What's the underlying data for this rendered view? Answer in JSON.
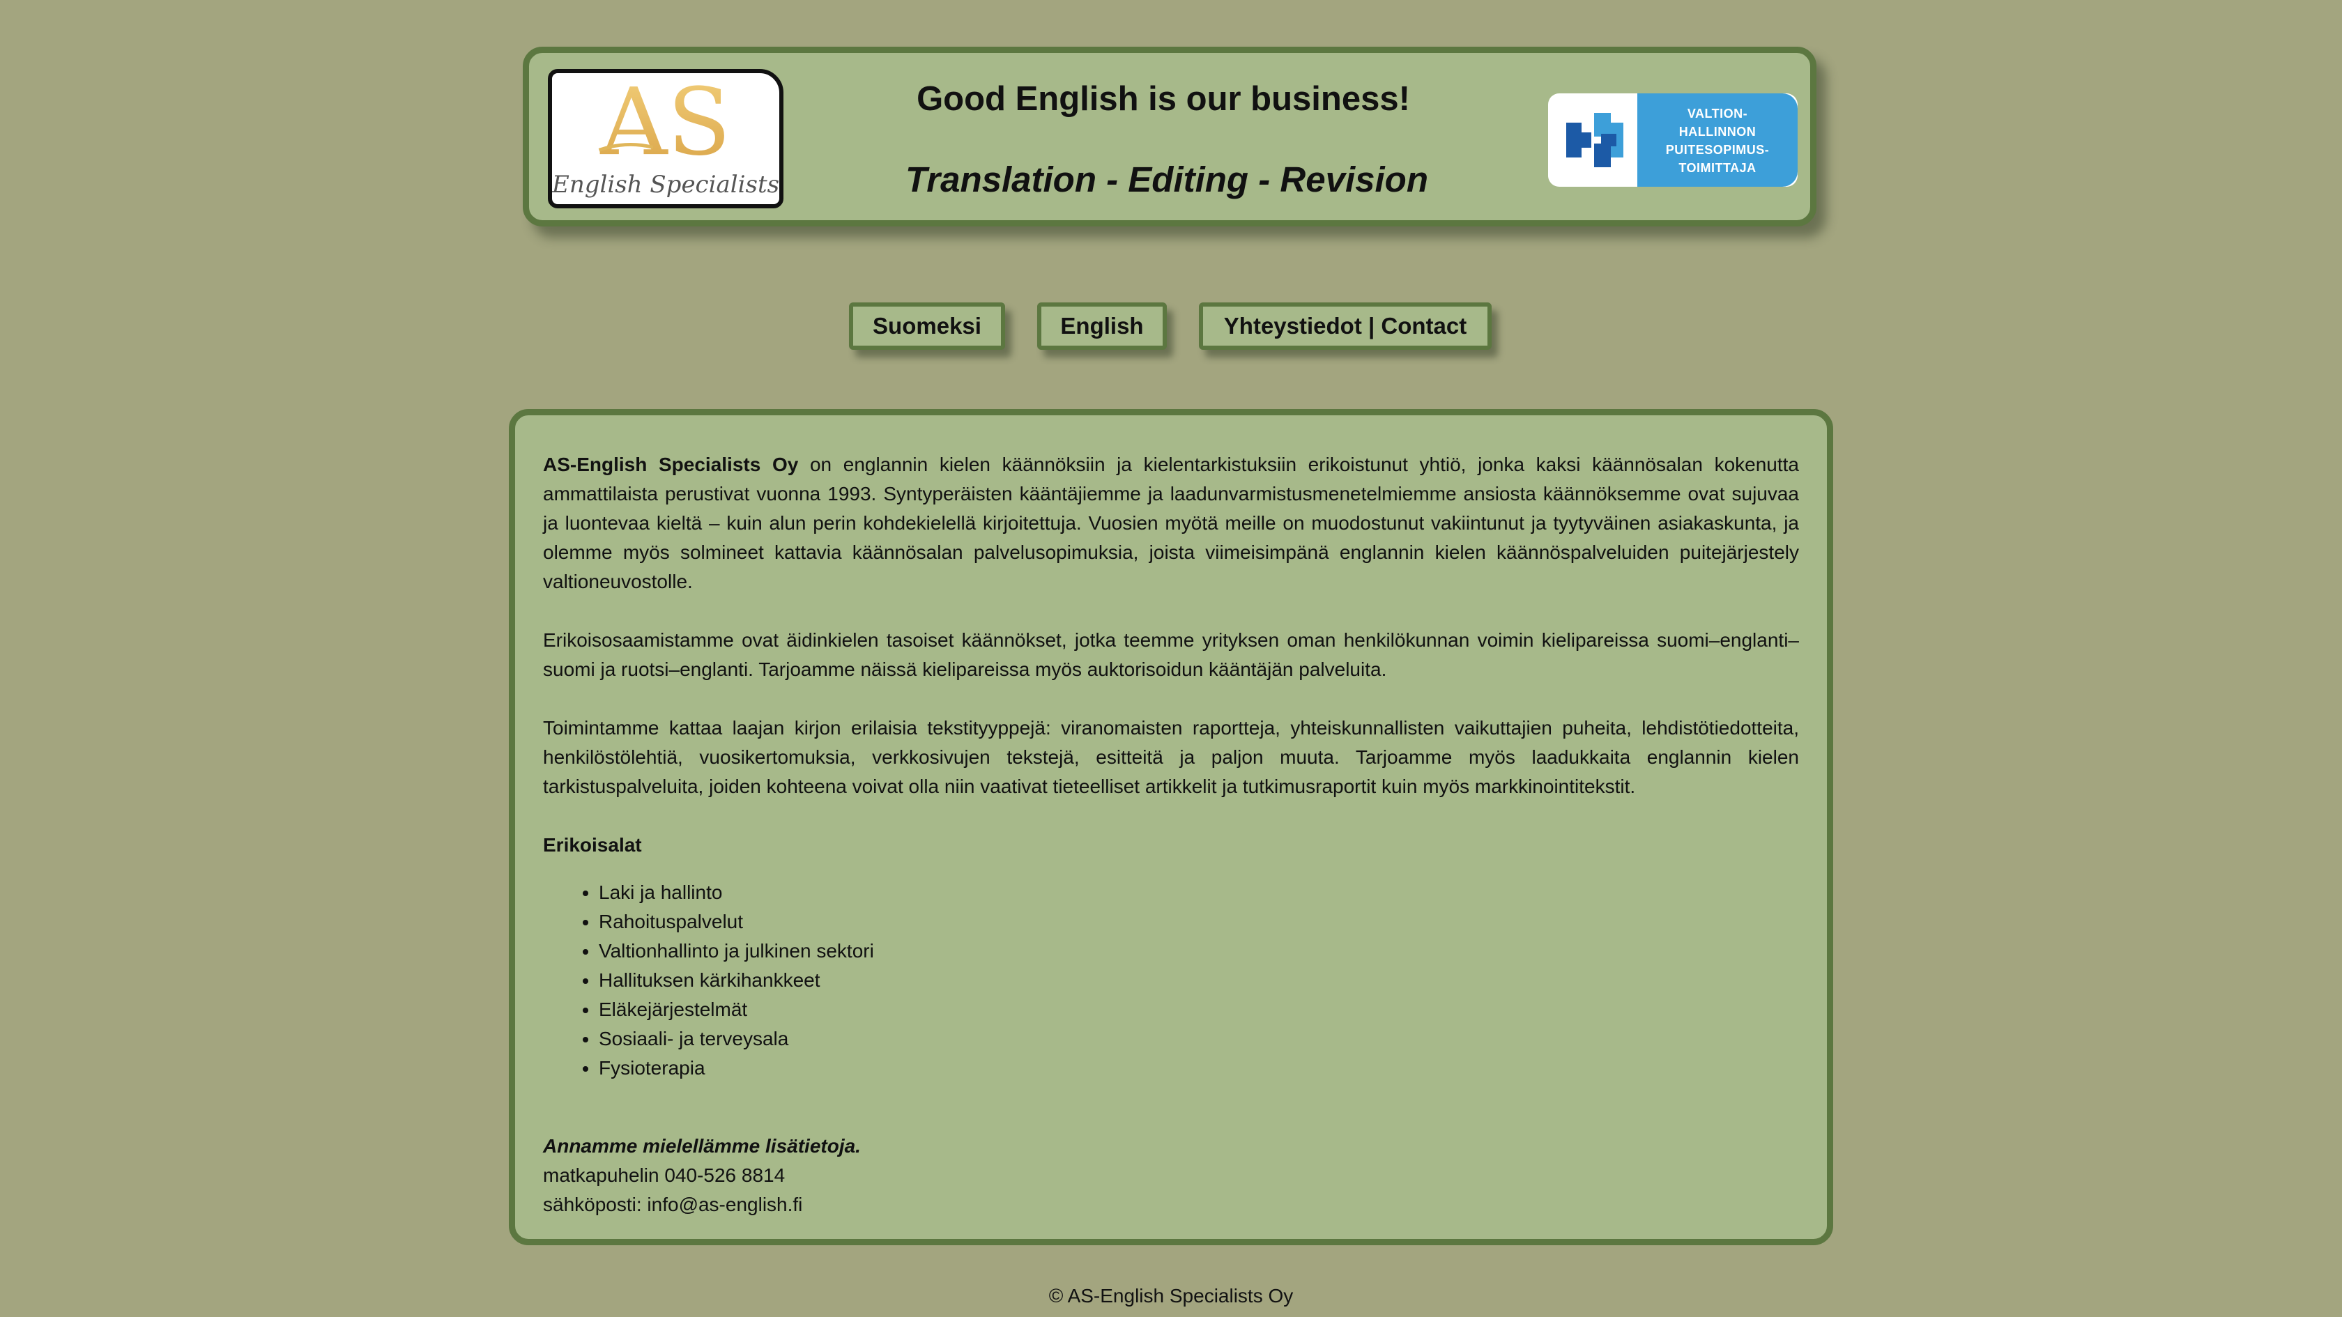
{
  "colors": {
    "page_background": "#a3a57f",
    "panel_background": "#a7b98a",
    "panel_border": "#5c7740",
    "logo_gold": "#e0b65a",
    "badge_blue": "#3d9fd9",
    "badge_dark_blue": "#1c5aa6"
  },
  "header": {
    "logo_text": "AS",
    "logo_subtext": "English Specialists Oy",
    "title": "Good English is our business!",
    "subtitle": "Translation - Editing - Revision",
    "badge_text": "VALTION-\nHALLINNON\nPUITESOPIMUS-\nTOIMITTAJA",
    "badge_icon": "puzzle-badge-icon"
  },
  "nav": {
    "finnish_label": "Suomeksi",
    "english_label": "English",
    "contact_label": "Yhteystiedot | Contact"
  },
  "main": {
    "intro_company": "AS-English Specialists Oy",
    "intro_rest": " on englannin kielen käännöksiin ja kielentarkistuksiin erikoistunut yhtiö, jonka kaksi käännösalan kokenutta ammattilaista perustivat vuonna 1993. Syntyperäisten kääntäjiemme ja laadunvarmistusmenetelmiemme ansiosta käännöksemme ovat sujuvaa ja luontevaa kieltä – kuin alun perin kohdekielellä kirjoitettuja. Vuosien myötä meille on muodostunut vakiintunut ja tyytyväinen asiakaskunta, ja olemme myös solmineet kattavia käännösalan palvelusopimuksia, joista viimeisimpänä englannin kielen käännöspalveluiden puitejärjestely valtioneuvostolle.",
    "paragraph_2": "Erikoisosaamistamme ovat äidinkielen tasoiset käännökset, jotka teemme yrityksen oman henkilökunnan voimin kielipareissa suomi–englanti–suomi ja ruotsi–englanti. Tarjoamme näissä kielipareissa myös auktorisoidun kääntäjän palveluita.",
    "paragraph_3": "Toimintamme kattaa laajan kirjon erilaisia tekstityyppejä: viranomaisten raportteja, yhteiskunnallisten vaikuttajien puheita, lehdistötiedotteita, henkilöstölehtiä, vuosikertomuksia, verkkosivujen tekstejä, esitteitä ja paljon muuta. Tarjoamme myös laadukkaita englannin kielen tarkistuspalveluita, joiden kohteena voivat olla niin vaativat tieteelliset artikkelit ja tutkimusraportit kuin myös markkinointitekstit.",
    "specialties_heading": "Erikoisalat",
    "specialties": [
      "Laki ja hallinto",
      "Rahoituspalvelut",
      "Valtionhallinto ja julkinen sektori",
      "Hallituksen kärkihankkeet",
      "Eläkejärjestelmät",
      "Sosiaali- ja terveysala",
      "Fysioterapia"
    ],
    "contact_lead": "Annamme mielellämme lisätietoja.",
    "phone": "matkapuhelin 040-526 8814",
    "email": "sähköposti: info@as-english.fi"
  },
  "footer": {
    "copyright": "© AS-English Specialists Oy"
  }
}
